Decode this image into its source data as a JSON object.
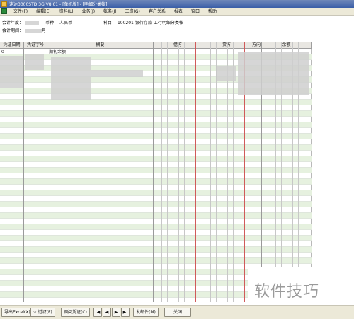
{
  "window": {
    "title": "速达3000STD 3G V8.61 - [单机版] - [明细分类帐]"
  },
  "menubar": {
    "items": [
      "文件(F)",
      "编辑(E)",
      "资料(L)",
      "业务(J)",
      "帐务(J)",
      "工资(G)",
      "客户关系",
      "报表",
      "窗口",
      "帮助"
    ]
  },
  "info": {
    "fiscal_year_label": "会计年度：",
    "currency_label": "币种：",
    "currency_value": "人民币",
    "account_label": "科目：",
    "account_value": "100201 银行存款-工行明细分类帐",
    "period_label": "会计期间：",
    "period_suffix": "月"
  },
  "table": {
    "headers": [
      "凭证日期",
      "凭证字号",
      "摘要",
      "借方",
      "贷方",
      "方向",
      "余额"
    ],
    "first_row_summary": "期初余额",
    "first_row_partial": "0"
  },
  "toolbar": {
    "export_excel": "导出Excel(X)",
    "filter": "过滤(F)",
    "view_voucher": "调阅凭证(C)",
    "send_email": "发邮件(M)",
    "close": "关闭"
  },
  "watermark": {
    "text": "软件技巧"
  },
  "colors": {
    "row_stripe": "#e6f1df",
    "debit_separator": "#2e9b3d",
    "credit_separator": "#d05a5a"
  }
}
